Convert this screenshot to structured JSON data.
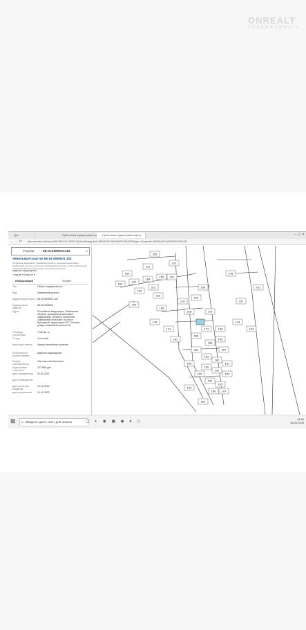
{
  "watermark": {
    "brand": "ONREALT",
    "sub": "НЕДВИЖИМОСТЬ"
  },
  "browser": {
    "tabs": [
      {
        "label": "Док"
      },
      {
        "label": "Публичная кадастровая карта"
      },
      {
        "label": "Публичная кадастровая карта"
      }
    ],
    "nav": "← → ⟳",
    "url": "pkk.rosreestr.ru/#/search/52.6435,42.1338/17/@1ml49mbqg?text=68%3A15%3A4905001%3A152&type=1&opened=68%3A15%3A4905001%3A152"
  },
  "panel": {
    "search_label": "Участки",
    "search_value": "68:15:4905001:152",
    "title": "Земельный участок 68:15:4905001:152",
    "subtitle": "Российская Федерация, Тамбовская область, муниципальный район Тамбовский, сельское поселение Тамбовский сельсовет, посёлок Бригадный, территория СНТ Зелёная улица, земельный участок 16",
    "view": "ведение садоводства",
    "links": "Отвр.де ▾    Отвр.ле ▾",
    "tab_info": "Информация",
    "tab_services": "Услуги",
    "rows": [
      {
        "k": "Тип",
        "v": "Объект недвижимости"
      },
      {
        "k": "Вид",
        "v": "Земельный участок"
      },
      {
        "k": "Кадастровый номер",
        "v": "68:15:4905001:152"
      },
      {
        "k": "Кадастровый квартал",
        "v": "68:15:4905001"
      },
      {
        "k": "Адрес",
        "v": "Российская Федерация, Тамбовская область, муниципальный район Тамбовский, сельское поселение Тамбовский сельсовет, посёлок Бригадный, территория СНТ Зеленая улица, земельный участок 16"
      },
      {
        "k": "Площадь уточненная",
        "v": "1 500 кв. м"
      },
      {
        "k": "Статус",
        "v": "Учтенный"
      },
      {
        "k": "Категория земель",
        "v": "Земли населённых пунктов"
      },
      {
        "k": "Разрешенное использование",
        "v": "ведение садоводства"
      },
      {
        "k": "Форма собственности",
        "v": "Частная собственность"
      },
      {
        "k": "Кадастровая стоимость",
        "v": "137 580 руб."
      },
      {
        "k": "дата определения",
        "v": "01.01.2022"
      },
      {
        "k": "дата утверждения",
        "v": ""
      },
      {
        "k": "дата внесения сведений",
        "v": "22.12.2022"
      },
      {
        "k": "дата применения",
        "v": "01.01.2023"
      }
    ]
  },
  "map": {
    "plots": [
      "205",
      "130",
      "162",
      "163",
      "164",
      "165",
      "160",
      "222",
      "201",
      "210",
      "211",
      "212",
      "130",
      "166",
      "214",
      "218",
      "213",
      "195",
      "176",
      "145",
      "237",
      "173",
      "138",
      "158",
      "188",
      "145",
      "183",
      "159",
      "182",
      "187",
      "191",
      "190",
      "192",
      "193",
      "194",
      "195",
      "196",
      "197",
      "198",
      "199",
      "190",
      "161",
      "141",
      "142",
      "143",
      "144",
      "191",
      "192"
    ],
    "copyright": "Росреестр 2010-2023 | Esri ©"
  },
  "taskbar": {
    "search_placeholder": "Введите здесь текст для поиска",
    "icons": "▢ ◐ ◉ ▣ ◆ ● ◇",
    "tray_time": "14:30",
    "tray_date": "15.02.2023"
  }
}
